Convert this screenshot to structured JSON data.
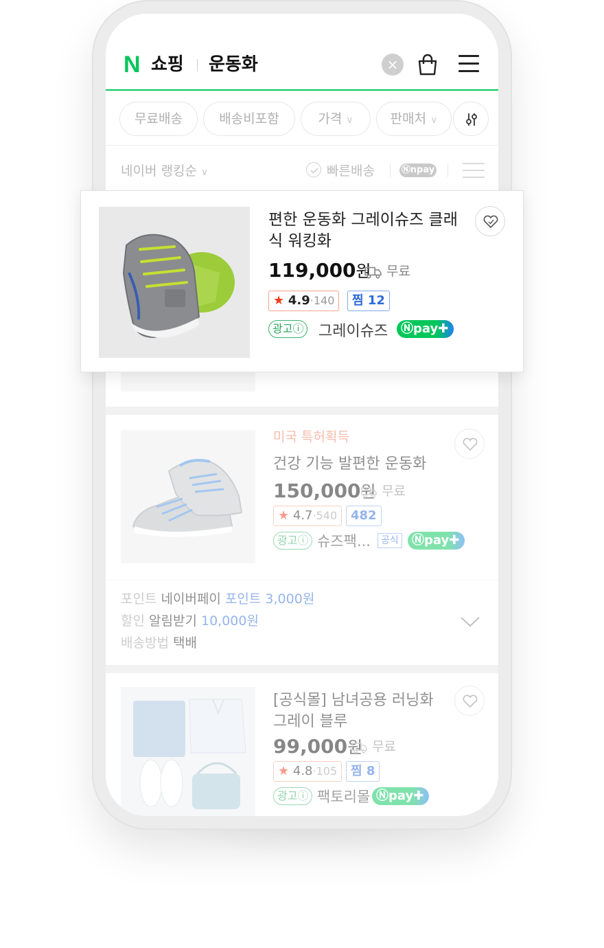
{
  "header": {
    "logo_n": "N",
    "logo_text": "쇼핑",
    "query": "운동화",
    "clear_icon": "close-icon",
    "cart_icon": "shopping-bag-icon",
    "menu_icon": "hamburger-menu-icon"
  },
  "filters": {
    "chips": [
      "무료배송",
      "배송비포함",
      "가격",
      "판매처"
    ],
    "settings_icon": "filter-sliders-icon"
  },
  "sort": {
    "label": "네이버 랭킹순",
    "fast_delivery": "빠른배송",
    "npay": "npay"
  },
  "featured": {
    "title": "편한 운동화 그레이슈즈 클래식 워킹화",
    "price": "119,000",
    "won": "원",
    "shipping": "무료",
    "rating": "4.9",
    "reviews": "140",
    "zzim": "찜 12",
    "ad": "광고",
    "seller": "그레이슈즈",
    "npay": "pay"
  },
  "product2": {
    "badge": "미국 특허획득",
    "title": "건강 기능 발편한 운동화",
    "price": "150,000",
    "won": "원",
    "shipping": "무료",
    "rating": "4.7",
    "reviews": "540",
    "zzim": "482",
    "ad": "광고",
    "seller": "슈즈팩...",
    "official": "공식",
    "npay": "pay"
  },
  "promo": {
    "point_key": "포인트",
    "point_value": "네이버페이",
    "point_blue": "포인트 3,000원",
    "discount_key": "할인",
    "discount_value": "알림받기",
    "discount_blue": "10,000원",
    "ship_key": "배송방법",
    "ship_value": "택배"
  },
  "product3": {
    "title": "[공식몰] 남녀공용 러닝화 그레이 블루",
    "price": "99,000",
    "won": "원",
    "shipping": "무료",
    "rating": "4.8",
    "reviews": "105",
    "zzim": "찜 8",
    "ad": "광고",
    "seller": "팩토리몰",
    "npay": "pay"
  },
  "colors": {
    "naver_green": "#03c75a",
    "npay_blue": "#1e82f0",
    "link_blue": "#2d6bd8",
    "star_red": "#f03c19",
    "badge_coral": "#f07a5a"
  }
}
